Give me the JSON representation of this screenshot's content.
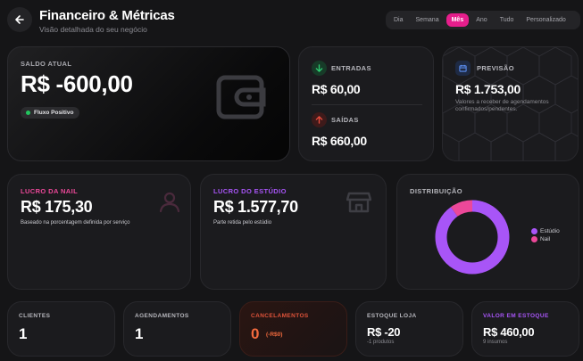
{
  "header": {
    "title": "Financeiro & Métricas",
    "subtitle": "Visão detalhada do seu negócio",
    "periods": [
      "Dia",
      "Semana",
      "Mês",
      "Ano",
      "Tudo",
      "Personalizado"
    ],
    "active_period": "Mês"
  },
  "balance": {
    "label": "SALDO ATUAL",
    "value": "R$ -600,00",
    "badge": "Fluxo Positivo",
    "icon": "wallet-icon"
  },
  "entradas": {
    "label": "ENTRADAS",
    "value": "R$ 60,00",
    "icon": "arrow-down-icon",
    "color": "#2ecc71"
  },
  "saidas": {
    "label": "SAÍDAS",
    "value": "R$ 660,00",
    "icon": "arrow-up-icon",
    "color": "#e74c3c"
  },
  "previsao": {
    "label": "PREVISÃO",
    "value": "R$ 1.753,00",
    "description_line1": "Valores a receber de agendamentos",
    "description_line2": "confirmados/pendentes.",
    "icon": "calendar-icon"
  },
  "lucro_nail": {
    "label": "LUCRO DA NAIL",
    "value": "R$ 175,30",
    "description": "Baseado na porcentagem definida por serviço",
    "icon": "user-icon",
    "color": "#ec4899"
  },
  "lucro_estudio": {
    "label": "LUCRO DO ESTÚDIO",
    "value": "R$ 1.577,70",
    "description": "Parte retida pelo estúdio",
    "icon": "store-icon",
    "color": "#a855f7"
  },
  "distribuicao": {
    "label": "DISTRIBUIÇÃO",
    "legend": [
      {
        "name": "Estúdio",
        "color": "#a855f7"
      },
      {
        "name": "Nail",
        "color": "#ec4899"
      }
    ],
    "shares": [
      90,
      10
    ]
  },
  "stats": {
    "clientes": {
      "label": "CLIENTES",
      "value": "1"
    },
    "agendamentos": {
      "label": "AGENDAMENTOS",
      "value": "1"
    },
    "cancelamentos": {
      "label": "CANCELAMENTOS",
      "value": "0",
      "sub": "(-R$0)"
    },
    "estoque_loja": {
      "label": "ESTOQUE LOJA",
      "value": "R$ -20",
      "sub": "-1 produtos"
    },
    "valor_estoque": {
      "label": "VALOR EM ESTOQUE",
      "value": "R$ 460,00",
      "sub": "9 insumos"
    }
  }
}
